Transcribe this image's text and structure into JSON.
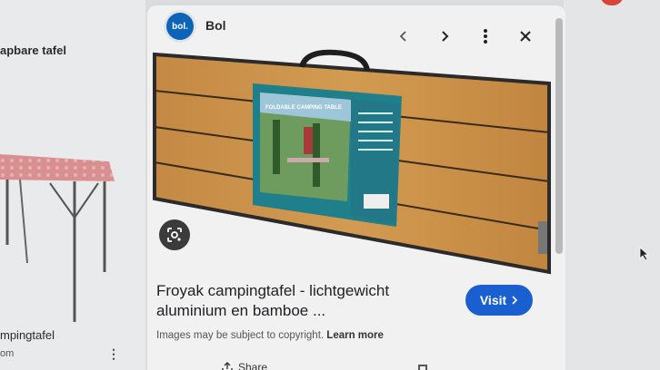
{
  "left_results": {
    "top_title": "apbare tafel",
    "caption": "mpingtafel",
    "source": "om",
    "menu_icon": "more-vert-icon"
  },
  "preview": {
    "source": {
      "logo_text": "bol.",
      "name": "Bol"
    },
    "controls": {
      "prev_icon": "chevron-left-icon",
      "next_icon": "chevron-right-icon",
      "more_icon": "more-vert-icon",
      "close_icon": "close-icon"
    },
    "product_box_title": "FOLDABLE CAMPING TABLE",
    "title_line1": "Froyak campingtafel - lichtgewicht",
    "title_line2": "aluminium en bamboe ...",
    "visit_label": "Visit",
    "visit_icon": "chevron-right-icon",
    "copyright_text": "Images may be subject to copyright.",
    "learn_more": "Learn more",
    "share_label": "Share",
    "lens_icon": "google-lens-icon"
  },
  "colors": {
    "visit_button": "#1a5fd0",
    "bol_logo": "#0c63b8"
  }
}
